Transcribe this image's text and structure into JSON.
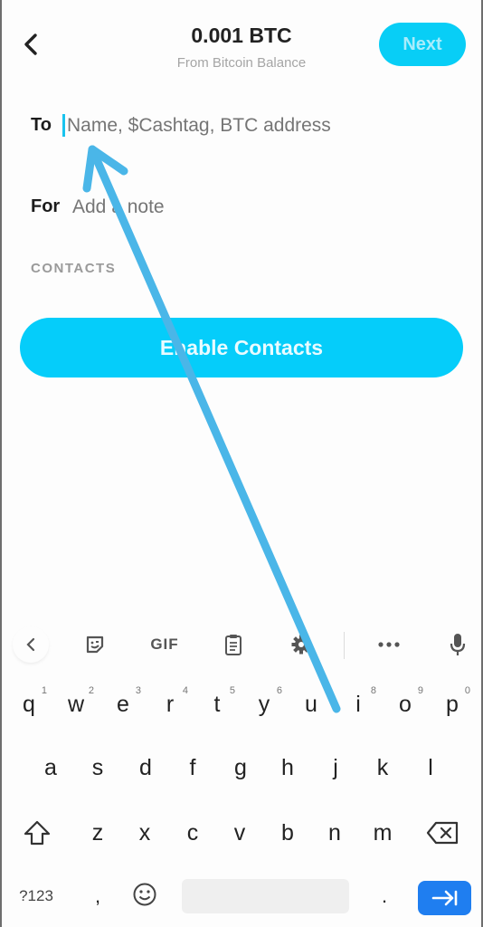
{
  "header": {
    "title": "0.001 BTC",
    "subtitle": "From Bitcoin Balance",
    "next_label": "Next"
  },
  "form": {
    "to_label": "To",
    "to_placeholder": "Name, $Cashtag, BTC address",
    "to_value": "",
    "for_label": "For",
    "for_placeholder": "Add a note",
    "for_value": ""
  },
  "contacts": {
    "section_label": "CONTACTS",
    "enable_label": "Enable Contacts"
  },
  "colors": {
    "accent": "#05cdfa",
    "annotation_arrow": "#4ab6e8",
    "keyboard_enter": "#1f7ef0"
  },
  "keyboard": {
    "toolbar": {
      "gif_label": "GIF",
      "icons": [
        "chevron-left-icon",
        "sticker-icon",
        "gif-icon",
        "clipboard-icon",
        "gear-icon",
        "more-icon",
        "microphone-icon"
      ]
    },
    "row1": [
      {
        "key": "q",
        "hint": "1"
      },
      {
        "key": "w",
        "hint": "2"
      },
      {
        "key": "e",
        "hint": "3"
      },
      {
        "key": "r",
        "hint": "4"
      },
      {
        "key": "t",
        "hint": "5"
      },
      {
        "key": "y",
        "hint": "6"
      },
      {
        "key": "u",
        "hint": "7"
      },
      {
        "key": "i",
        "hint": "8"
      },
      {
        "key": "o",
        "hint": "9"
      },
      {
        "key": "p",
        "hint": "0"
      }
    ],
    "row2": [
      "a",
      "s",
      "d",
      "f",
      "g",
      "h",
      "j",
      "k",
      "l"
    ],
    "row3": [
      "z",
      "x",
      "c",
      "v",
      "b",
      "n",
      "m"
    ],
    "row4": {
      "symbols_label": "?123",
      "comma": ",",
      "period": "."
    }
  },
  "annotation": {
    "type": "arrow",
    "points_to": "to-recipient-input"
  }
}
